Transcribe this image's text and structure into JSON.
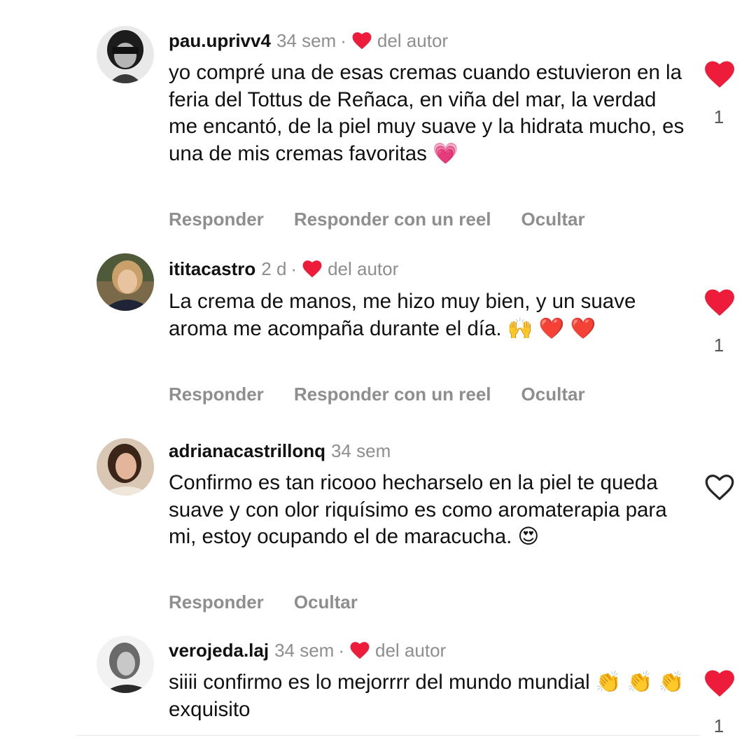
{
  "colors": {
    "heart_red": "#ed1c3a",
    "muted_text": "#8e8e8e",
    "text": "#111111"
  },
  "comments": [
    {
      "username": "pau.uprivv4",
      "time": "34 sem",
      "separator": "·",
      "author_like_label": "del autor",
      "text": "yo compré una de esas cremas cuando estuvieron en la feria del Tottus de Reñaca, en viña del mar, la verdad me encantó, de la piel muy suave y la hidrata mucho, es una de mis cremas favoritas 💗",
      "actions": [
        "Responder",
        "Responder con un reel",
        "Ocultar"
      ],
      "liked": true,
      "like_count": "1",
      "icon": "heart-filled-icon"
    },
    {
      "username": "ititacastro",
      "time": "2 d",
      "separator": "·",
      "author_like_label": "del autor",
      "text": "La crema de manos, me hizo muy bien, y un suave aroma me acompaña durante el día. 🙌 ❤️ ❤️",
      "actions": [
        "Responder",
        "Responder con un reel",
        "Ocultar"
      ],
      "liked": true,
      "like_count": "1",
      "icon": "heart-filled-icon"
    },
    {
      "username": "adrianacastrillonq",
      "time": "34 sem",
      "text": "Confirmo es tan ricooo hecharselo en la piel te queda suave y con olor riquísimo es como aromaterapia para mi, estoy ocupando el de maracucha. 😍",
      "actions": [
        "Responder",
        "Ocultar"
      ],
      "liked": false,
      "icon": "heart-outline-icon"
    },
    {
      "username": "verojeda.laj",
      "time": "34 sem",
      "separator": "·",
      "author_like_label": "del autor",
      "text": "siiii confirmo es lo mejorrrr del mundo mundial 👏 👏 👏 exquisito",
      "liked": true,
      "like_count": "1",
      "icon": "heart-filled-icon"
    }
  ]
}
